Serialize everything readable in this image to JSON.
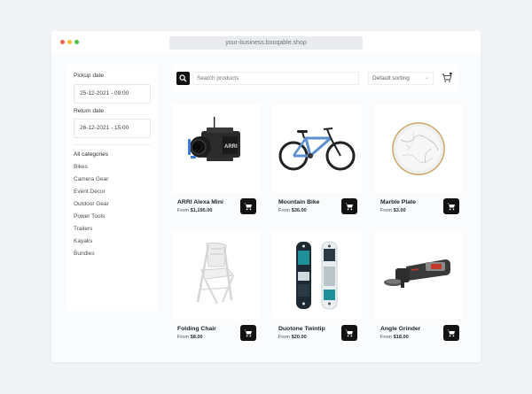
{
  "browser": {
    "url": "your-business.booqable.shop"
  },
  "sidebar": {
    "pickup_label": "Pickup date",
    "pickup_value": "25-12-2021 - 09:00",
    "return_label": "Return date",
    "return_value": "26-12-2021 - 15:00",
    "categories": [
      "All categories",
      "Bikes",
      "Camera Gear",
      "Event Decor",
      "Outdoor Gear",
      "Power Tools",
      "Trailers",
      "Kayaks",
      "Bundles"
    ]
  },
  "toolbar": {
    "search_placeholder": "Search products",
    "sort_value": "Default sorting"
  },
  "products": [
    {
      "name": "ARRI Alexa Mini",
      "price_prefix": "From",
      "price": "$1,195.00",
      "icon": "cinema-camera"
    },
    {
      "name": "Mountain Bike",
      "price_prefix": "From",
      "price": "$36.00",
      "icon": "bicycle"
    },
    {
      "name": "Marble Plate",
      "price_prefix": "From",
      "price": "$3.00",
      "icon": "plate"
    },
    {
      "name": "Folding Chair",
      "price_prefix": "From",
      "price": "$8.00",
      "icon": "chair"
    },
    {
      "name": "Duotone Twintip",
      "price_prefix": "From",
      "price": "$20.00",
      "icon": "kiteboard"
    },
    {
      "name": "Angle Grinder",
      "price_prefix": "From",
      "price": "$18.00",
      "icon": "angle-grinder"
    }
  ]
}
